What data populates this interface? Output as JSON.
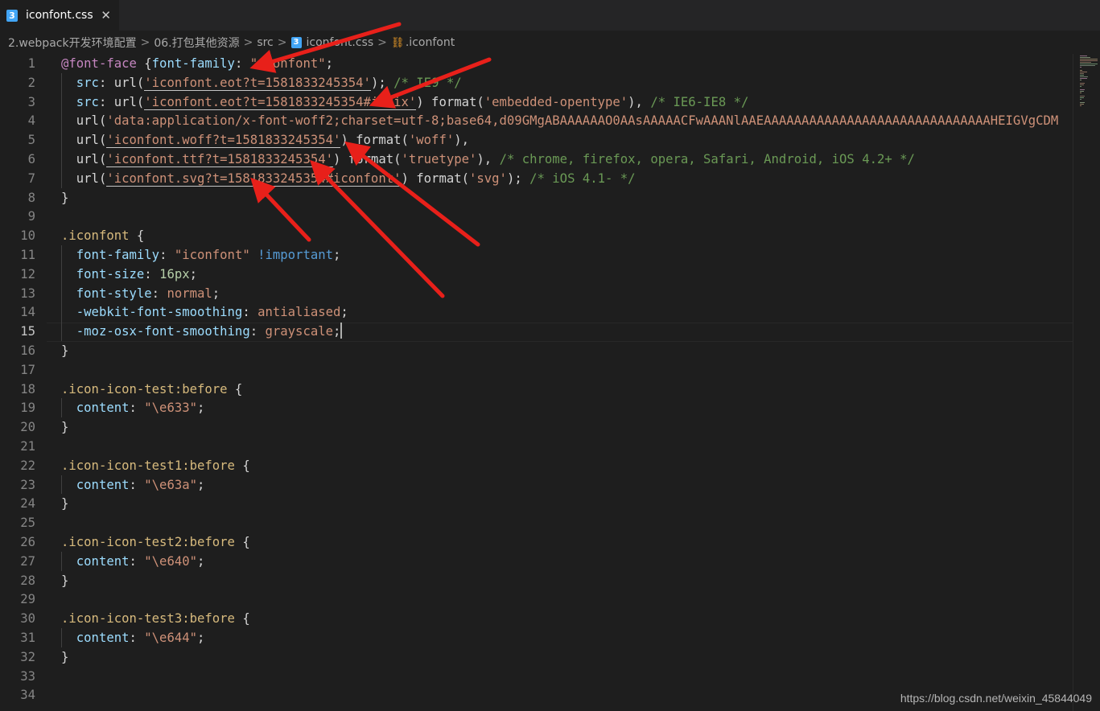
{
  "tab": {
    "icon": "css3-file-icon",
    "label": "iconfont.css",
    "close": "✕"
  },
  "breadcrumb": {
    "items": [
      "2.webpack开发环境配置",
      "06.打包其他资源",
      "src",
      "iconfont.css",
      ".iconfont"
    ],
    "separator": ">"
  },
  "editor": {
    "active_line": 15,
    "lines": [
      [
        [
          "@font-face",
          "k"
        ],
        [
          " {",
          "f"
        ],
        [
          "font-family",
          "p"
        ],
        [
          ": ",
          "f"
        ],
        [
          "\"iconfont\"",
          "str"
        ],
        [
          ";",
          "f"
        ]
      ],
      [
        [
          "  src",
          "p"
        ],
        [
          ": url(",
          "f"
        ],
        [
          "'iconfont.eot?t=1581833245354'",
          "str u"
        ],
        [
          "); ",
          "f"
        ],
        [
          "/* IE9 */",
          "c"
        ]
      ],
      [
        [
          "  src",
          "p"
        ],
        [
          ": url(",
          "f"
        ],
        [
          "'iconfont.eot?t=1581833245354#iefix'",
          "str u"
        ],
        [
          ") format(",
          "f"
        ],
        [
          "'embedded-opentype'",
          "str"
        ],
        [
          "), ",
          "f"
        ],
        [
          "/* IE6-IE8 */",
          "c"
        ]
      ],
      [
        [
          "  url(",
          "f"
        ],
        [
          "'data:application/x-font-woff2;charset=utf-8;base64,d09GMgABAAAAAAO0AAsAAAAACFwAAANlAAEAAAAAAAAAAAAAAAAAAAAAAAAAAAAAAHEIGVgCDM",
          "str"
        ]
      ],
      [
        [
          "  url(",
          "f"
        ],
        [
          "'iconfont.woff?t=1581833245354'",
          "str u"
        ],
        [
          ") format(",
          "f"
        ],
        [
          "'woff'",
          "str"
        ],
        [
          "),",
          "f"
        ]
      ],
      [
        [
          "  url(",
          "f"
        ],
        [
          "'iconfont.ttf?t=1581833245354'",
          "str u"
        ],
        [
          ") format(",
          "f"
        ],
        [
          "'truetype'",
          "str"
        ],
        [
          "), ",
          "f"
        ],
        [
          "/* chrome, firefox, opera, Safari, Android, iOS 4.2+ */",
          "c"
        ]
      ],
      [
        [
          "  url(",
          "f"
        ],
        [
          "'iconfont.svg?t=1581833245354#iconfont'",
          "str u"
        ],
        [
          ") format(",
          "f"
        ],
        [
          "'svg'",
          "str"
        ],
        [
          "); ",
          "f"
        ],
        [
          "/* iOS 4.1- */",
          "c"
        ]
      ],
      [
        [
          "}",
          "f"
        ]
      ],
      [],
      [
        [
          ".iconfont",
          "s"
        ],
        [
          " {",
          "f"
        ]
      ],
      [
        [
          "  font-family",
          "p"
        ],
        [
          ": ",
          "f"
        ],
        [
          "\"iconfont\"",
          "str"
        ],
        [
          " ",
          "f"
        ],
        [
          "!important",
          "kw"
        ],
        [
          ";",
          "f"
        ]
      ],
      [
        [
          "  font-size",
          "p"
        ],
        [
          ": ",
          "f"
        ],
        [
          "16px",
          "n"
        ],
        [
          ";",
          "f"
        ]
      ],
      [
        [
          "  font-style",
          "p"
        ],
        [
          ": ",
          "f"
        ],
        [
          "normal",
          "str"
        ],
        [
          ";",
          "f"
        ]
      ],
      [
        [
          "  -webkit-font-smoothing",
          "p"
        ],
        [
          ": ",
          "f"
        ],
        [
          "antialiased",
          "str"
        ],
        [
          ";",
          "f"
        ]
      ],
      [
        [
          "  -moz-osx-font-smoothing",
          "p"
        ],
        [
          ": ",
          "f"
        ],
        [
          "grayscale",
          "str"
        ],
        [
          ";",
          "f"
        ]
      ],
      [
        [
          "}",
          "f"
        ]
      ],
      [],
      [
        [
          ".icon-icon-test:before",
          "s"
        ],
        [
          " {",
          "f"
        ]
      ],
      [
        [
          "  content",
          "p"
        ],
        [
          ": ",
          "f"
        ],
        [
          "\"\\e633\"",
          "str"
        ],
        [
          ";",
          "f"
        ]
      ],
      [
        [
          "}",
          "f"
        ]
      ],
      [],
      [
        [
          ".icon-icon-test1:before",
          "s"
        ],
        [
          " {",
          "f"
        ]
      ],
      [
        [
          "  content",
          "p"
        ],
        [
          ": ",
          "f"
        ],
        [
          "\"\\e63a\"",
          "str"
        ],
        [
          ";",
          "f"
        ]
      ],
      [
        [
          "}",
          "f"
        ]
      ],
      [],
      [
        [
          ".icon-icon-test2:before",
          "s"
        ],
        [
          " {",
          "f"
        ]
      ],
      [
        [
          "  content",
          "p"
        ],
        [
          ": ",
          "f"
        ],
        [
          "\"\\e640\"",
          "str"
        ],
        [
          ";",
          "f"
        ]
      ],
      [
        [
          "}",
          "f"
        ]
      ],
      [],
      [
        [
          ".icon-icon-test3:before",
          "s"
        ],
        [
          " {",
          "f"
        ]
      ],
      [
        [
          "  content",
          "p"
        ],
        [
          ": ",
          "f"
        ],
        [
          "\"\\e644\"",
          "str"
        ],
        [
          ";",
          "f"
        ]
      ],
      [
        [
          "}",
          "f"
        ]
      ],
      [],
      []
    ]
  },
  "watermark": "https://blog.csdn.net/weixin_45844049",
  "colors": {
    "background": "#1e1e1e",
    "tabbar": "#252526",
    "keyword": "#c586c0",
    "selector": "#d7ba7d",
    "property": "#9cdcfe",
    "string": "#ce9178",
    "comment": "#6a9955",
    "number": "#b5cea8",
    "important": "#569cd6",
    "arrow": "#e8201a"
  }
}
